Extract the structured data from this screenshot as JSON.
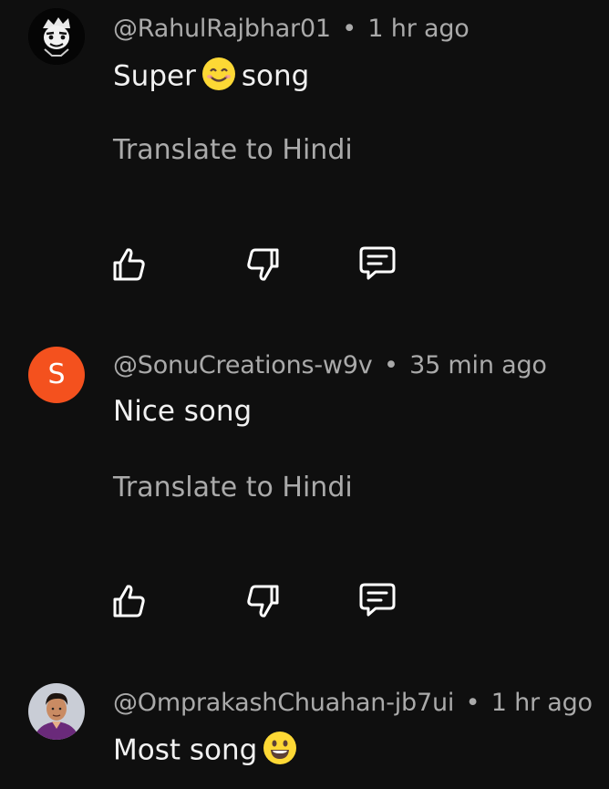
{
  "comments": [
    {
      "handle": "@RahulRajbhar01",
      "separator": "•",
      "time": "1 hr ago",
      "text_before": "Super",
      "emoji": "smiling-face-icon",
      "text_after": "song",
      "translate": "Translate to Hindi",
      "avatar": "cartoon-character-avatar"
    },
    {
      "handle": "@SonuCreations-w9v",
      "separator": "•",
      "time": "35 min ago",
      "text": "Nice song",
      "translate": "Translate to Hindi",
      "avatar_letter": "S",
      "avatar_color": "#f4511e"
    },
    {
      "handle": "@OmprakashChuahan-jb7ui",
      "separator": "•",
      "time": "1 hr ago",
      "text_before": "Most song",
      "emoji": "grinning-face-icon",
      "avatar": "person-photo-avatar"
    }
  ],
  "colors": {
    "background": "#0f0f0f",
    "meta_text": "#aaaaaa",
    "body_text": "#f1f1f1",
    "icon_stroke": "#ffffff"
  }
}
